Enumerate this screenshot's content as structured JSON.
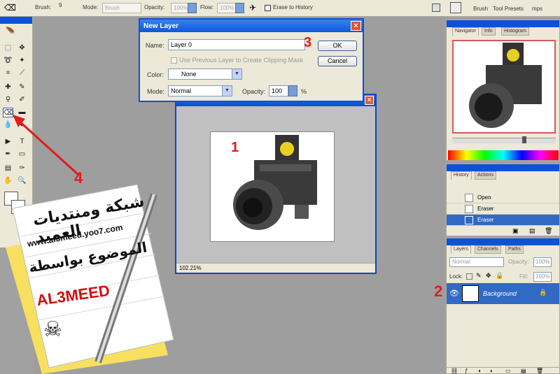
{
  "options_bar": {
    "brush_label": "Brush:",
    "brush_size": "9",
    "mode_label": "Mode:",
    "mode_value": "Brush",
    "opacity_label": "Opacity:",
    "opacity_value": "100%",
    "flow_label": "Flow:",
    "flow_value": "100%",
    "erase_to_history_label": "Erase to History",
    "palette_tabs": [
      "Brush",
      "Tool Presets",
      "mps"
    ]
  },
  "dialog": {
    "title": "New Layer",
    "name_label": "Name:",
    "name_value": "Layer 0",
    "use_previous_label": "Use Previous Layer to Create Clipping Mask",
    "color_label": "Color:",
    "color_value": "None",
    "mode_label": "Mode:",
    "mode_value": "Normal",
    "opacity_label": "Opacity:",
    "opacity_value": "100",
    "opacity_unit": "%",
    "ok_label": "OK",
    "cancel_label": "Cancel"
  },
  "document": {
    "zoom": "102.21%"
  },
  "navigator": {
    "tabs": [
      "Navigator",
      "Info",
      "Histogram"
    ]
  },
  "history": {
    "tabs": [
      "History",
      "Actions"
    ],
    "items": [
      {
        "label": "Open",
        "selected": false
      },
      {
        "label": "Eraser",
        "selected": false
      },
      {
        "label": "Eraser",
        "selected": true
      }
    ]
  },
  "layers": {
    "tabs": [
      "Layers",
      "Channels",
      "Paths"
    ],
    "blend_mode": "Normal",
    "opacity_label": "Opacity:",
    "opacity_value": "100%",
    "lock_label": "Lock:",
    "fill_label": "Fill:",
    "fill_value": "100%",
    "layer_name": "Background"
  },
  "annotations": {
    "step1": "1",
    "step2": "2",
    "step3": "3",
    "step4": "4",
    "color": "#e31b1b"
  },
  "sticker": {
    "arabic_title": "شبكة ومنتديات العميد",
    "url": "www.al3meed.yoo7.com",
    "arabic_sub": "الموضوع بواسطة",
    "brand": "AL3MEED"
  },
  "colors": {
    "title_bar": "#0b52d6",
    "selection": "#316ac5",
    "annotation": "#e31b1b"
  }
}
